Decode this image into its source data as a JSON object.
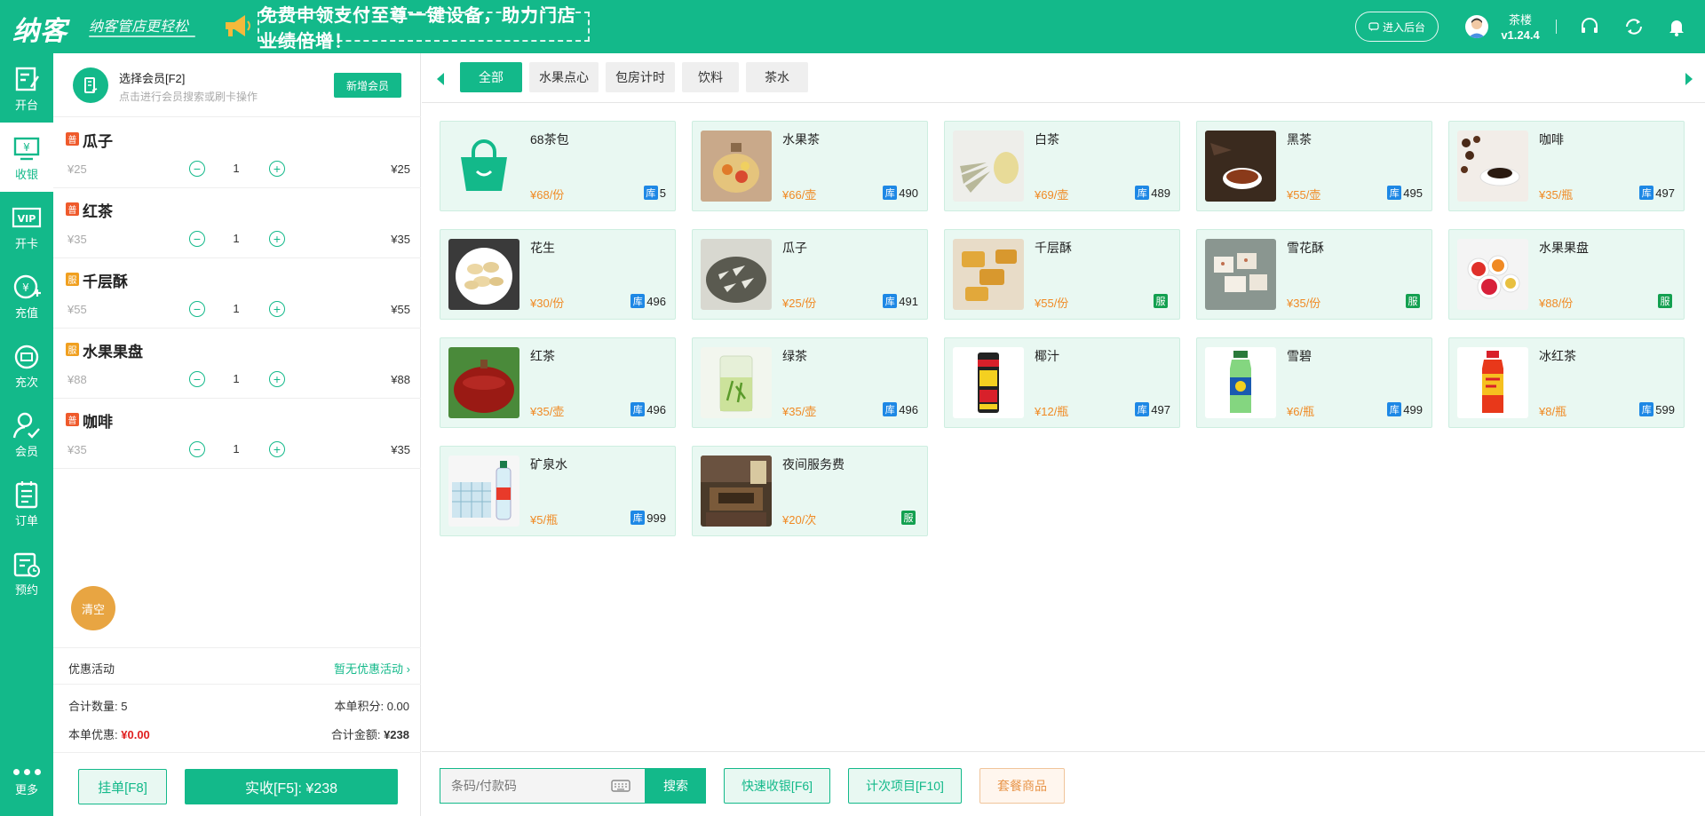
{
  "header": {
    "logo": "纳客",
    "slogan": "纳客管店更轻松",
    "promo_text": "免费申领支付至尊一键设备，助力门店业绩倍增！",
    "admin_button": "进入后台",
    "username": "茶楼",
    "version": "v1.24.4",
    "icons": [
      "megaphone-icon",
      "chat-icon",
      "headset-icon",
      "refresh-icon",
      "bell-icon",
      "user-avatar-icon"
    ]
  },
  "nav": {
    "items": [
      {
        "label": "开台",
        "icon": "table-icon"
      },
      {
        "label": "收银",
        "icon": "cashier-icon",
        "active": true
      },
      {
        "label": "开卡",
        "icon": "vip-card-icon"
      },
      {
        "label": "充值",
        "icon": "recharge-icon"
      },
      {
        "label": "充次",
        "icon": "times-icon"
      },
      {
        "label": "会员",
        "icon": "member-icon"
      },
      {
        "label": "订单",
        "icon": "order-icon"
      },
      {
        "label": "预约",
        "icon": "reserve-icon"
      }
    ],
    "more_label": "更多"
  },
  "cart": {
    "member_title": "选择会员[F2]",
    "member_hint": "点击进行会员搜索或刷卡操作",
    "add_member": "新增会员",
    "items": [
      {
        "tag": "普",
        "name": "瓜子",
        "price": "¥25",
        "qty": "1",
        "total": "¥25"
      },
      {
        "tag": "普",
        "name": "红茶",
        "price": "¥35",
        "qty": "1",
        "total": "¥35"
      },
      {
        "tag": "服",
        "name": "千层酥",
        "price": "¥55",
        "qty": "1",
        "total": "¥55"
      },
      {
        "tag": "服",
        "name": "水果果盘",
        "price": "¥88",
        "qty": "1",
        "total": "¥88"
      },
      {
        "tag": "普",
        "name": "咖啡",
        "price": "¥35",
        "qty": "1",
        "total": "¥35"
      }
    ],
    "clear": "清空",
    "promo_label": "优惠活动",
    "promo_value": "暂无优惠活动",
    "count_label": "合计数量:",
    "count_value": "5",
    "points_label": "本单积分:",
    "points_value": "0.00",
    "discount_label": "本单优惠:",
    "discount_value": "¥0.00",
    "amount_label": "合计金额:",
    "amount_value": "¥238",
    "hang_button": "挂单[F8]",
    "pay_button": "实收[F5]: ¥238"
  },
  "tabs": [
    "全部",
    "水果点心",
    "包房计时",
    "饮料",
    "茶水"
  ],
  "products": [
    {
      "name": "68茶包",
      "price": "¥68/份",
      "stock_tag": "库",
      "stock": "5",
      "img": "bag"
    },
    {
      "name": "水果茶",
      "price": "¥66/壶",
      "stock_tag": "库",
      "stock": "490",
      "img": "fruittea"
    },
    {
      "name": "白茶",
      "price": "¥69/壶",
      "stock_tag": "库",
      "stock": "489",
      "img": "whitetea"
    },
    {
      "name": "黑茶",
      "price": "¥55/壶",
      "stock_tag": "库",
      "stock": "495",
      "img": "blacktea"
    },
    {
      "name": "咖啡",
      "price": "¥35/瓶",
      "stock_tag": "库",
      "stock": "497",
      "img": "coffee"
    },
    {
      "name": "花生",
      "price": "¥30/份",
      "stock_tag": "库",
      "stock": "496",
      "img": "peanut"
    },
    {
      "name": "瓜子",
      "price": "¥25/份",
      "stock_tag": "库",
      "stock": "491",
      "img": "seeds"
    },
    {
      "name": "千层酥",
      "price": "¥55/份",
      "service_tag": "服",
      "img": "pastry"
    },
    {
      "name": "雪花酥",
      "price": "¥35/份",
      "service_tag": "服",
      "img": "snow"
    },
    {
      "name": "水果果盘",
      "price": "¥88/份",
      "service_tag": "服",
      "img": "fruitplate"
    },
    {
      "name": "红茶",
      "price": "¥35/壶",
      "stock_tag": "库",
      "stock": "496",
      "img": "redtea"
    },
    {
      "name": "绿茶",
      "price": "¥35/壶",
      "stock_tag": "库",
      "stock": "496",
      "img": "greentea"
    },
    {
      "name": "椰汁",
      "price": "¥12/瓶",
      "stock_tag": "库",
      "stock": "497",
      "img": "coconut"
    },
    {
      "name": "雪碧",
      "price": "¥6/瓶",
      "stock_tag": "库",
      "stock": "499",
      "img": "sprite"
    },
    {
      "name": "冰红茶",
      "price": "¥8/瓶",
      "stock_tag": "库",
      "stock": "599",
      "img": "icetea"
    },
    {
      "name": "矿泉水",
      "price": "¥5/瓶",
      "stock_tag": "库",
      "stock": "999",
      "img": "water"
    },
    {
      "name": "夜间服务费",
      "price": "¥20/次",
      "service_tag": "服",
      "img": "room"
    }
  ],
  "bottom": {
    "search_placeholder": "条码/付款码",
    "search_button": "搜索",
    "quick_cash": "快速收银[F6]",
    "count_item": "计次项目[F10]",
    "package": "套餐商品"
  },
  "colors": {
    "primary": "#13b98a",
    "orange": "#f08a24",
    "red": "#e02020",
    "stock_blue": "#1e88e5"
  }
}
